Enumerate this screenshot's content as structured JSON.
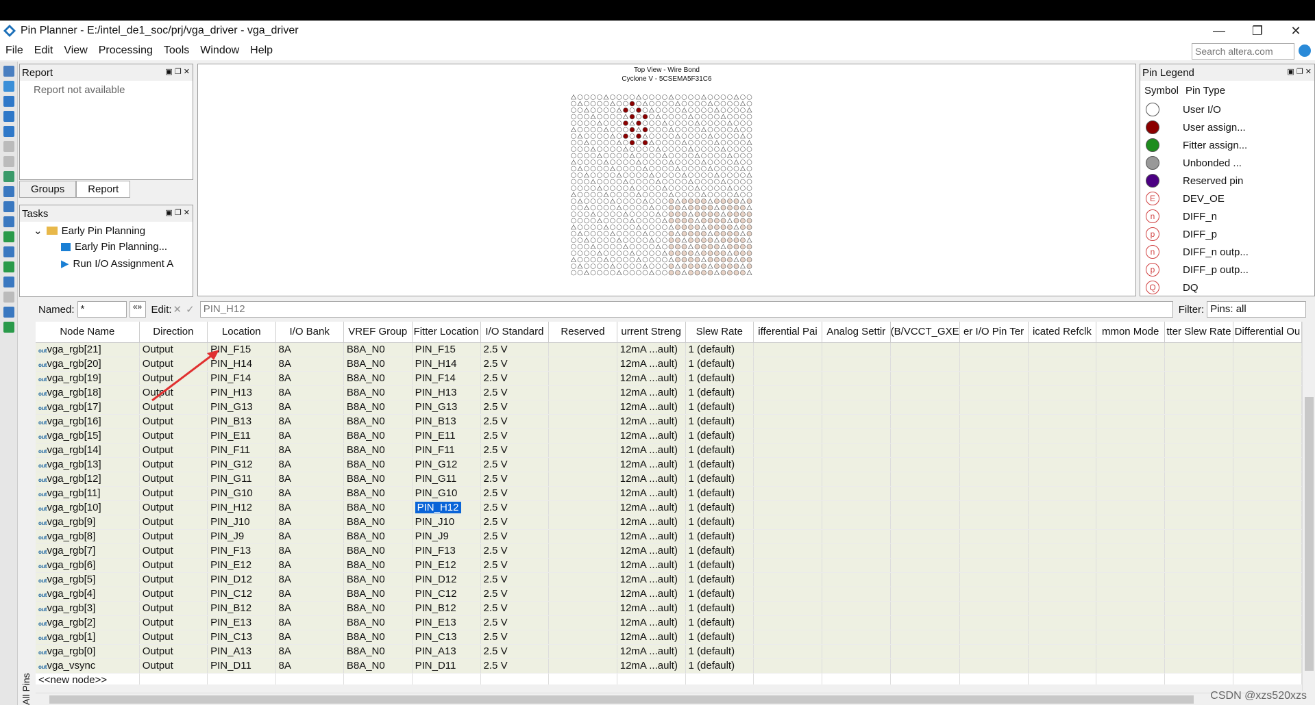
{
  "window": {
    "title": "Pin Planner - E:/intel_de1_soc/prj/vga_driver - vga_driver",
    "controls": {
      "minimize": "—",
      "restore": "❐",
      "close": "✕"
    }
  },
  "menu": [
    "File",
    "Edit",
    "View",
    "Processing",
    "Tools",
    "Window",
    "Help"
  ],
  "search": {
    "placeholder": "Search altera.com"
  },
  "report_panel": {
    "title": "Report",
    "message": "Report not available",
    "tabs": [
      "Groups",
      "Report"
    ]
  },
  "tasks_panel": {
    "title": "Tasks",
    "items": [
      "Early Pin Planning",
      "Early Pin Planning...",
      "Run I/O Assignment A"
    ]
  },
  "chip_view": {
    "title": "Top View - Wire Bond",
    "subtitle": "Cyclone V - 5CSEMA5F31C6"
  },
  "pin_legend": {
    "title": "Pin Legend",
    "headers": {
      "symbol": "Symbol",
      "pin_type": "Pin Type"
    },
    "entries": [
      {
        "label": "User I/O",
        "color": "#ffffff"
      },
      {
        "label": "User assign...",
        "color": "#8b0000"
      },
      {
        "label": "Fitter assign...",
        "color": "#1e8c1e"
      },
      {
        "label": "Unbonded ...",
        "color": "#999999"
      },
      {
        "label": "Reserved pin",
        "color": "#4b0082"
      },
      {
        "label": "DEV_OE",
        "glyph": "E"
      },
      {
        "label": "DIFF_n",
        "glyph": "n"
      },
      {
        "label": "DIFF_p",
        "glyph": "p"
      },
      {
        "label": "DIFF_n outp...",
        "glyph": "n"
      },
      {
        "label": "DIFF_p outp...",
        "glyph": "p"
      },
      {
        "label": "DQ",
        "glyph": "Q"
      }
    ]
  },
  "filter_bar": {
    "named_label": "Named:",
    "named_value": "*",
    "more_btn": "«»",
    "edit_label": "Edit:",
    "edit_value": "PIN_H12",
    "filter_label": "Filter:",
    "filter_value": "Pins: all"
  },
  "table": {
    "columns": [
      "Node Name",
      "Direction",
      "Location",
      "I/O Bank",
      "VREF Group",
      "Fitter Location",
      "I/O Standard",
      "Reserved",
      "urrent Streng",
      "Slew Rate",
      "ifferential Pai",
      "Analog Settir",
      "(B/VCCT_GXE",
      "er I/O Pin Ter",
      "icated Refclk",
      "mmon Mode",
      "tter Slew Rate",
      "Differential Ou"
    ],
    "rows": [
      [
        "vga_rgb[21]",
        "Output",
        "PIN_F15",
        "8A",
        "B8A_N0",
        "PIN_F15",
        "2.5 V",
        "",
        "12mA ...ault)",
        "1 (default)"
      ],
      [
        "vga_rgb[20]",
        "Output",
        "PIN_H14",
        "8A",
        "B8A_N0",
        "PIN_H14",
        "2.5 V",
        "",
        "12mA ...ault)",
        "1 (default)"
      ],
      [
        "vga_rgb[19]",
        "Output",
        "PIN_F14",
        "8A",
        "B8A_N0",
        "PIN_F14",
        "2.5 V",
        "",
        "12mA ...ault)",
        "1 (default)"
      ],
      [
        "vga_rgb[18]",
        "Output",
        "PIN_H13",
        "8A",
        "B8A_N0",
        "PIN_H13",
        "2.5 V",
        "",
        "12mA ...ault)",
        "1 (default)"
      ],
      [
        "vga_rgb[17]",
        "Output",
        "PIN_G13",
        "8A",
        "B8A_N0",
        "PIN_G13",
        "2.5 V",
        "",
        "12mA ...ault)",
        "1 (default)"
      ],
      [
        "vga_rgb[16]",
        "Output",
        "PIN_B13",
        "8A",
        "B8A_N0",
        "PIN_B13",
        "2.5 V",
        "",
        "12mA ...ault)",
        "1 (default)"
      ],
      [
        "vga_rgb[15]",
        "Output",
        "PIN_E11",
        "8A",
        "B8A_N0",
        "PIN_E11",
        "2.5 V",
        "",
        "12mA ...ault)",
        "1 (default)"
      ],
      [
        "vga_rgb[14]",
        "Output",
        "PIN_F11",
        "8A",
        "B8A_N0",
        "PIN_F11",
        "2.5 V",
        "",
        "12mA ...ault)",
        "1 (default)"
      ],
      [
        "vga_rgb[13]",
        "Output",
        "PIN_G12",
        "8A",
        "B8A_N0",
        "PIN_G12",
        "2.5 V",
        "",
        "12mA ...ault)",
        "1 (default)"
      ],
      [
        "vga_rgb[12]",
        "Output",
        "PIN_G11",
        "8A",
        "B8A_N0",
        "PIN_G11",
        "2.5 V",
        "",
        "12mA ...ault)",
        "1 (default)"
      ],
      [
        "vga_rgb[11]",
        "Output",
        "PIN_G10",
        "8A",
        "B8A_N0",
        "PIN_G10",
        "2.5 V",
        "",
        "12mA ...ault)",
        "1 (default)"
      ],
      [
        "vga_rgb[10]",
        "Output",
        "PIN_H12",
        "8A",
        "B8A_N0",
        "PIN_H12",
        "2.5 V",
        "",
        "12mA ...ault)",
        "1 (default)"
      ],
      [
        "vga_rgb[9]",
        "Output",
        "PIN_J10",
        "8A",
        "B8A_N0",
        "PIN_J10",
        "2.5 V",
        "",
        "12mA ...ault)",
        "1 (default)"
      ],
      [
        "vga_rgb[8]",
        "Output",
        "PIN_J9",
        "8A",
        "B8A_N0",
        "PIN_J9",
        "2.5 V",
        "",
        "12mA ...ault)",
        "1 (default)"
      ],
      [
        "vga_rgb[7]",
        "Output",
        "PIN_F13",
        "8A",
        "B8A_N0",
        "PIN_F13",
        "2.5 V",
        "",
        "12mA ...ault)",
        "1 (default)"
      ],
      [
        "vga_rgb[6]",
        "Output",
        "PIN_E12",
        "8A",
        "B8A_N0",
        "PIN_E12",
        "2.5 V",
        "",
        "12mA ...ault)",
        "1 (default)"
      ],
      [
        "vga_rgb[5]",
        "Output",
        "PIN_D12",
        "8A",
        "B8A_N0",
        "PIN_D12",
        "2.5 V",
        "",
        "12mA ...ault)",
        "1 (default)"
      ],
      [
        "vga_rgb[4]",
        "Output",
        "PIN_C12",
        "8A",
        "B8A_N0",
        "PIN_C12",
        "2.5 V",
        "",
        "12mA ...ault)",
        "1 (default)"
      ],
      [
        "vga_rgb[3]",
        "Output",
        "PIN_B12",
        "8A",
        "B8A_N0",
        "PIN_B12",
        "2.5 V",
        "",
        "12mA ...ault)",
        "1 (default)"
      ],
      [
        "vga_rgb[2]",
        "Output",
        "PIN_E13",
        "8A",
        "B8A_N0",
        "PIN_E13",
        "2.5 V",
        "",
        "12mA ...ault)",
        "1 (default)"
      ],
      [
        "vga_rgb[1]",
        "Output",
        "PIN_C13",
        "8A",
        "B8A_N0",
        "PIN_C13",
        "2.5 V",
        "",
        "12mA ...ault)",
        "1 (default)"
      ],
      [
        "vga_rgb[0]",
        "Output",
        "PIN_A13",
        "8A",
        "B8A_N0",
        "PIN_A13",
        "2.5 V",
        "",
        "12mA ...ault)",
        "1 (default)"
      ],
      [
        "vga_vsync",
        "Output",
        "PIN_D11",
        "8A",
        "B8A_N0",
        "PIN_D11",
        "2.5 V",
        "",
        "12mA ...ault)",
        "1 (default)"
      ]
    ],
    "new_node": "<<new node>>",
    "selected_row": 11,
    "selected_col": 5,
    "row_icon": "out"
  },
  "side_tab": "All Pins",
  "watermark": "CSDN @xzs520xzs",
  "colors": {
    "accent": "#0a64d8",
    "row_bg": "#eef0e2",
    "user_assigned": "#8b0000",
    "arrow": "#e03030"
  }
}
